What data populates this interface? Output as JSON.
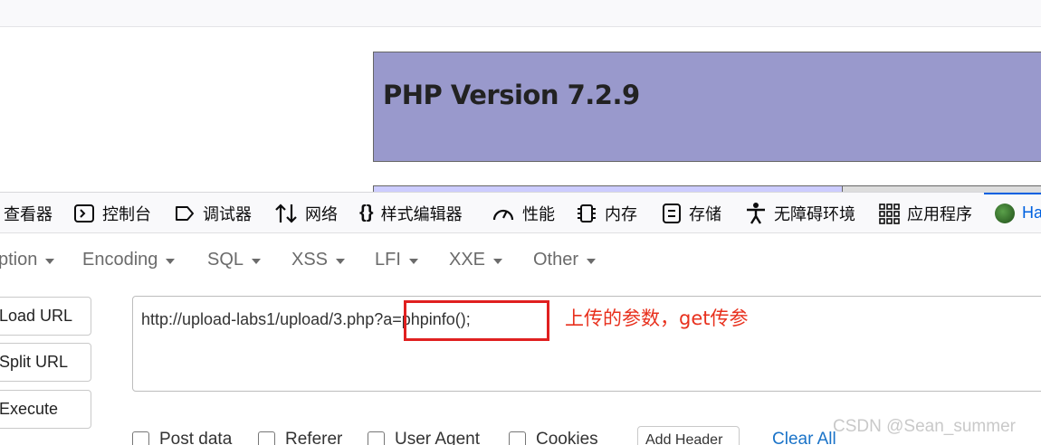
{
  "php_info": {
    "title": "PHP Version 7.2.9",
    "header_bg": "#9999cc"
  },
  "devtools": {
    "tabs": [
      {
        "label": "查看器",
        "icon": "inspector-icon"
      },
      {
        "label": "控制台",
        "icon": "console-icon"
      },
      {
        "label": "调试器",
        "icon": "debugger-icon"
      },
      {
        "label": "网络",
        "icon": "network-icon"
      },
      {
        "label": "样式编辑器",
        "icon": "style-editor-icon"
      },
      {
        "label": "性能",
        "icon": "performance-icon"
      },
      {
        "label": "内存",
        "icon": "memory-icon"
      },
      {
        "label": "存储",
        "icon": "storage-icon"
      },
      {
        "label": "无障碍环境",
        "icon": "accessibility-icon"
      },
      {
        "label": "应用程序",
        "icon": "application-icon"
      },
      {
        "label": "Ha",
        "icon": "hackbar-icon"
      }
    ],
    "active_color": "#0061e0"
  },
  "hackbar": {
    "menus": [
      "ption",
      "Encoding",
      "SQL",
      "XSS",
      "LFI",
      "XXE",
      "Other"
    ],
    "buttons": {
      "load_url": "Load URL",
      "split_url": "Split URL",
      "execute": "Execute"
    },
    "url_value": "http://upload-labs1/upload/3.php?a=phpinfo();",
    "annotation": "上传的参数，get传参",
    "annotation_color": "#e8301d",
    "options": [
      "Post data",
      "Referer",
      "User Agent",
      "Cookies"
    ],
    "add_header": "Add Header",
    "clear_all": "Clear All"
  },
  "watermark": "CSDN @Sean_summer"
}
